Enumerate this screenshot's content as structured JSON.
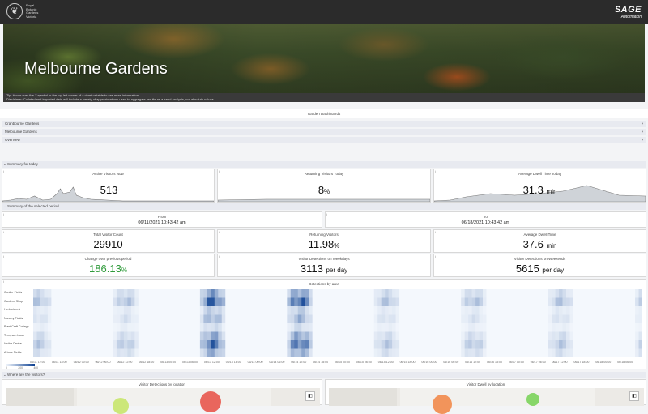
{
  "header": {
    "logo_text": [
      "Royal",
      "Botanic",
      "Gardens",
      "Victoria"
    ],
    "brand_big": "SAGE",
    "brand_small": "Automation"
  },
  "hero": {
    "title": "Melbourne Gardens",
    "tip": "Tip: Hover over the 'i' symbol in the top left corner of a chart or table to see more information.",
    "disclaimer": "Disclaimer: Collated and imported data will include a variety of approximations used to aggregate results as a trend analysis, not absolute values."
  },
  "garden_dashboards": {
    "title": "Garden Dashboards",
    "items": [
      "Cranbourne Gardens",
      "Melbourne Gardens",
      "Overview"
    ]
  },
  "summary_today": {
    "title": "Summary for today",
    "cards": [
      {
        "label": "Active Visitors Now",
        "value": "513",
        "unit": ""
      },
      {
        "label": "Returning Visitors Today",
        "value": "8",
        "unit": "%"
      },
      {
        "label": "Average Dwell Time Today",
        "value": "31.3",
        "unit": "min"
      }
    ]
  },
  "summary_period": {
    "title": "Summary of the selected period",
    "from_label": "From",
    "from_value": "06/11/2021 10:43:42 am",
    "to_label": "To",
    "to_value": "06/18/2021 10:43:42 am",
    "cards": [
      {
        "label": "Total Visitor Count",
        "value": "29910",
        "unit": ""
      },
      {
        "label": "Returning Visitors",
        "value": "11.98",
        "unit": "%"
      },
      {
        "label": "Average Dwell Time",
        "value": "37.6",
        "unit": "min"
      },
      {
        "label": "Change over previous period",
        "value": "186.13",
        "unit": "%"
      },
      {
        "label": "Visitor Detections on Weekdays",
        "value": "3113",
        "unit": "per day"
      },
      {
        "label": "Visitor Detections on Weekends",
        "value": "5615",
        "unit": "per day"
      }
    ]
  },
  "heatmap": {
    "title": "Detections by area",
    "rows": [
      "Conifer Fields",
      "Gardens Shop",
      "Herbarium A",
      "Nursery Fields",
      "Plant Craft Cottage",
      "Tennyson Lawn",
      "Visitor Centre",
      "Arbour Fields"
    ],
    "x_ticks": [
      "06/11 12:00",
      "06/11 18:00",
      "06/12 00:00",
      "06/12 06:00",
      "06/12 12:00",
      "06/12 18:00",
      "06/13 00:00",
      "06/13 06:00",
      "06/13 12:00",
      "06/13 18:00",
      "06/14 00:00",
      "06/14 06:00",
      "06/14 12:00",
      "06/14 18:00",
      "06/15 00:00",
      "06/15 06:00",
      "06/15 12:00",
      "06/15 18:00",
      "06/16 00:00",
      "06/16 06:00",
      "06/16 12:00",
      "06/16 18:00",
      "06/17 00:00",
      "06/17 06:00",
      "06/17 12:00",
      "06/17 18:00",
      "06/18 00:00",
      "06/18 06:00"
    ],
    "legend": [
      "0",
      "200",
      "400"
    ],
    "colors": {
      "low": "#f4f8fd",
      "high": "#0b3f91"
    }
  },
  "where": {
    "title": "Where are the visitors?",
    "left_title": "Visitor Detections by location",
    "right_title": "Visitor Dwell by location"
  }
}
